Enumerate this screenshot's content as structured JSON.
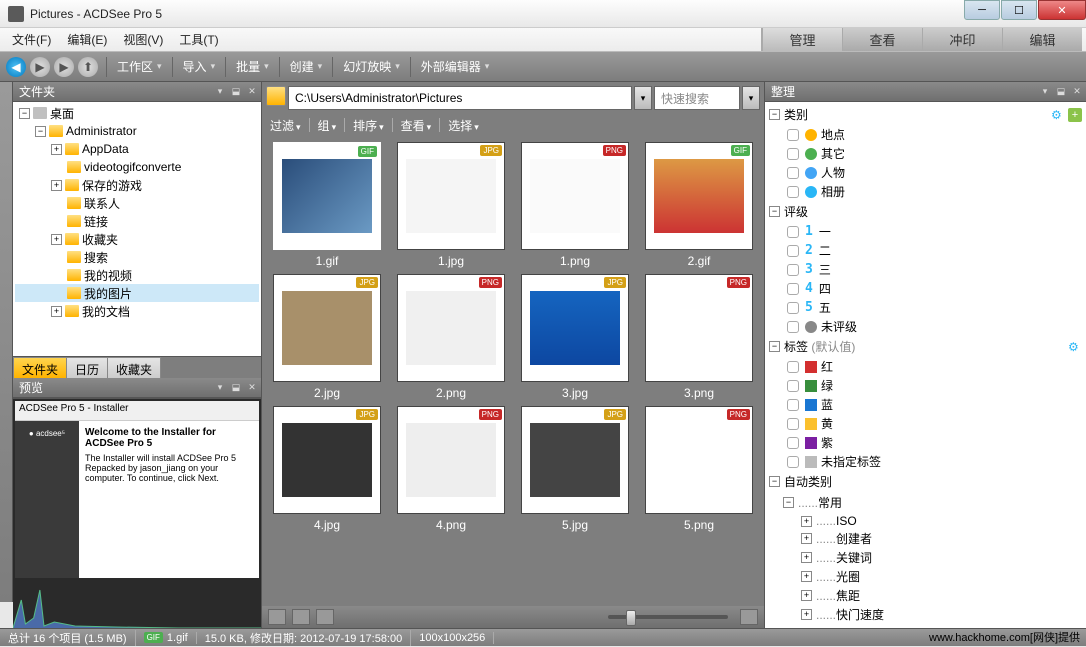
{
  "window": {
    "title": "Pictures - ACDSee Pro 5"
  },
  "menu": {
    "file": "文件(F)",
    "edit": "编辑(E)",
    "view": "视图(V)",
    "tools": "工具(T)"
  },
  "mode_tabs": {
    "manage": "管理",
    "view": "查看",
    "develop": "冲印",
    "edit": "编辑"
  },
  "toolbar": {
    "workspace": "工作区",
    "import": "导入",
    "batch": "批量",
    "create": "创建",
    "slideshow": "幻灯放映",
    "external": "外部编辑器"
  },
  "left": {
    "folders_title": "文件夹",
    "tabs": {
      "folders": "文件夹",
      "calendar": "日历",
      "favorites": "收藏夹"
    },
    "preview_title": "预览",
    "tree": {
      "desktop": "桌面",
      "admin": "Administrator",
      "appdata": "AppData",
      "videotogif": "videotogifconverte",
      "savedgames": "保存的游戏",
      "contacts": "联系人",
      "links": "链接",
      "favs": "收藏夹",
      "search": "搜索",
      "videos": "我的视频",
      "pictures": "我的图片",
      "documents": "我的文档"
    },
    "preview": {
      "caption": "ACDSee Pro 5 - Installer",
      "head": "Welcome to the Installer for ACDSee Pro 5",
      "body": "The Installer will install ACDSee Pro 5 Repacked by jason_jiang on your computer. To continue, click Next."
    }
  },
  "center": {
    "path": "C:\\Users\\Administrator\\Pictures",
    "search_placeholder": "快速搜索",
    "filter": "过滤",
    "group": "组",
    "sort": "排序",
    "viewmode": "查看",
    "select": "选择",
    "thumbs": [
      {
        "name": "1.gif",
        "type": "gif"
      },
      {
        "name": "1.jpg",
        "type": "jpg"
      },
      {
        "name": "1.png",
        "type": "png"
      },
      {
        "name": "2.gif",
        "type": "gif"
      },
      {
        "name": "2.jpg",
        "type": "jpg"
      },
      {
        "name": "2.png",
        "type": "png"
      },
      {
        "name": "3.jpg",
        "type": "jpg"
      },
      {
        "name": "3.png",
        "type": "png"
      },
      {
        "name": "4.jpg",
        "type": "jpg"
      },
      {
        "name": "4.png",
        "type": "png"
      },
      {
        "name": "5.jpg",
        "type": "jpg"
      },
      {
        "name": "5.png",
        "type": "png"
      }
    ]
  },
  "right": {
    "title": "整理",
    "categories": "类别",
    "cat": {
      "places": "地点",
      "other": "其它",
      "people": "人物",
      "albums": "相册"
    },
    "ratings": "评级",
    "rating": {
      "r1": "一",
      "r2": "二",
      "r3": "三",
      "r4": "四",
      "r5": "五",
      "none": "未评级"
    },
    "labels": "标签",
    "labels_default": "(默认值)",
    "lab": {
      "red": "红",
      "green": "绿",
      "blue": "蓝",
      "yellow": "黄",
      "purple": "紫",
      "none": "未指定标签"
    },
    "autocat": "自动类别",
    "common": "常用",
    "auto": {
      "iso": "ISO",
      "creator": "创建者",
      "keywords": "关键词",
      "aperture": "光圈",
      "focal": "焦距",
      "shutter": "快门速度"
    }
  },
  "status": {
    "total": "总计 16 个项目 (1.5 MB)",
    "sel_name": "1.gif",
    "sel_info": "15.0 KB, 修改日期: 2012-07-19 17:58:00",
    "dims": "100x100x256"
  },
  "watermark": "www.hackhome.com[网侠]提供"
}
